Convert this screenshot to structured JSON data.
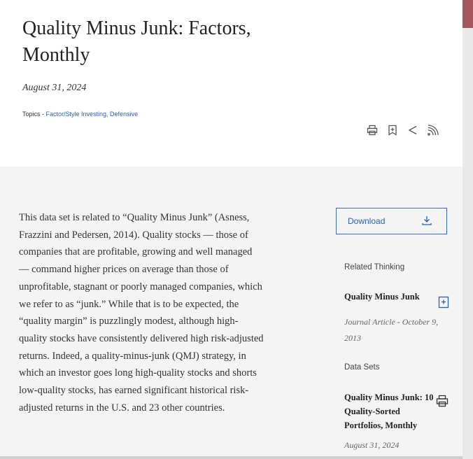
{
  "article": {
    "title": "Quality Minus Junk: Factors, Monthly",
    "date": "August 31, 2024",
    "topics_prefix": "Topics - ",
    "topics_links": "Factor/Style Investing, Defensive"
  },
  "actions": {
    "icons": [
      "print-icon",
      "bookmark-icon",
      "share-icon",
      "rss-icon"
    ]
  },
  "body": {
    "text": "This data set is related to “Quality Minus Junk” (Asness, Frazzini and Pedersen, 2014). Quality stocks — those of companies that are profitable, growing and well managed — command higher prices on average than those of unprofitable, stagnant or poorly managed companies, which we refer to as “junk.” While that is to be expected, the “quality margin” is puzzlingly modest, although high-quality stocks have consistently delivered high risk-adjusted returns. Indeed, a quality-minus-junk (QMJ) strategy, in which an investor goes long high-quality stocks and shorts low-quality stocks, has earned significant historical risk-adjusted returns in the U.S. and 23 other countries."
  },
  "sidebar": {
    "download_label": "Download",
    "related_label": "Related Thinking",
    "related_title": "Quality Minus Junk",
    "related_meta": "Journal Article - October 9, 2013",
    "datasets_label": "Data Sets",
    "dataset_title": "Quality Minus Junk: 10 Quality-Sorted Portfolios, Monthly",
    "dataset_date": "August 31, 2024"
  },
  "colors": {
    "accent": "#2b5fb4",
    "scroll_thumb": "#a5555c",
    "main_bg": "#f4f4f4"
  }
}
